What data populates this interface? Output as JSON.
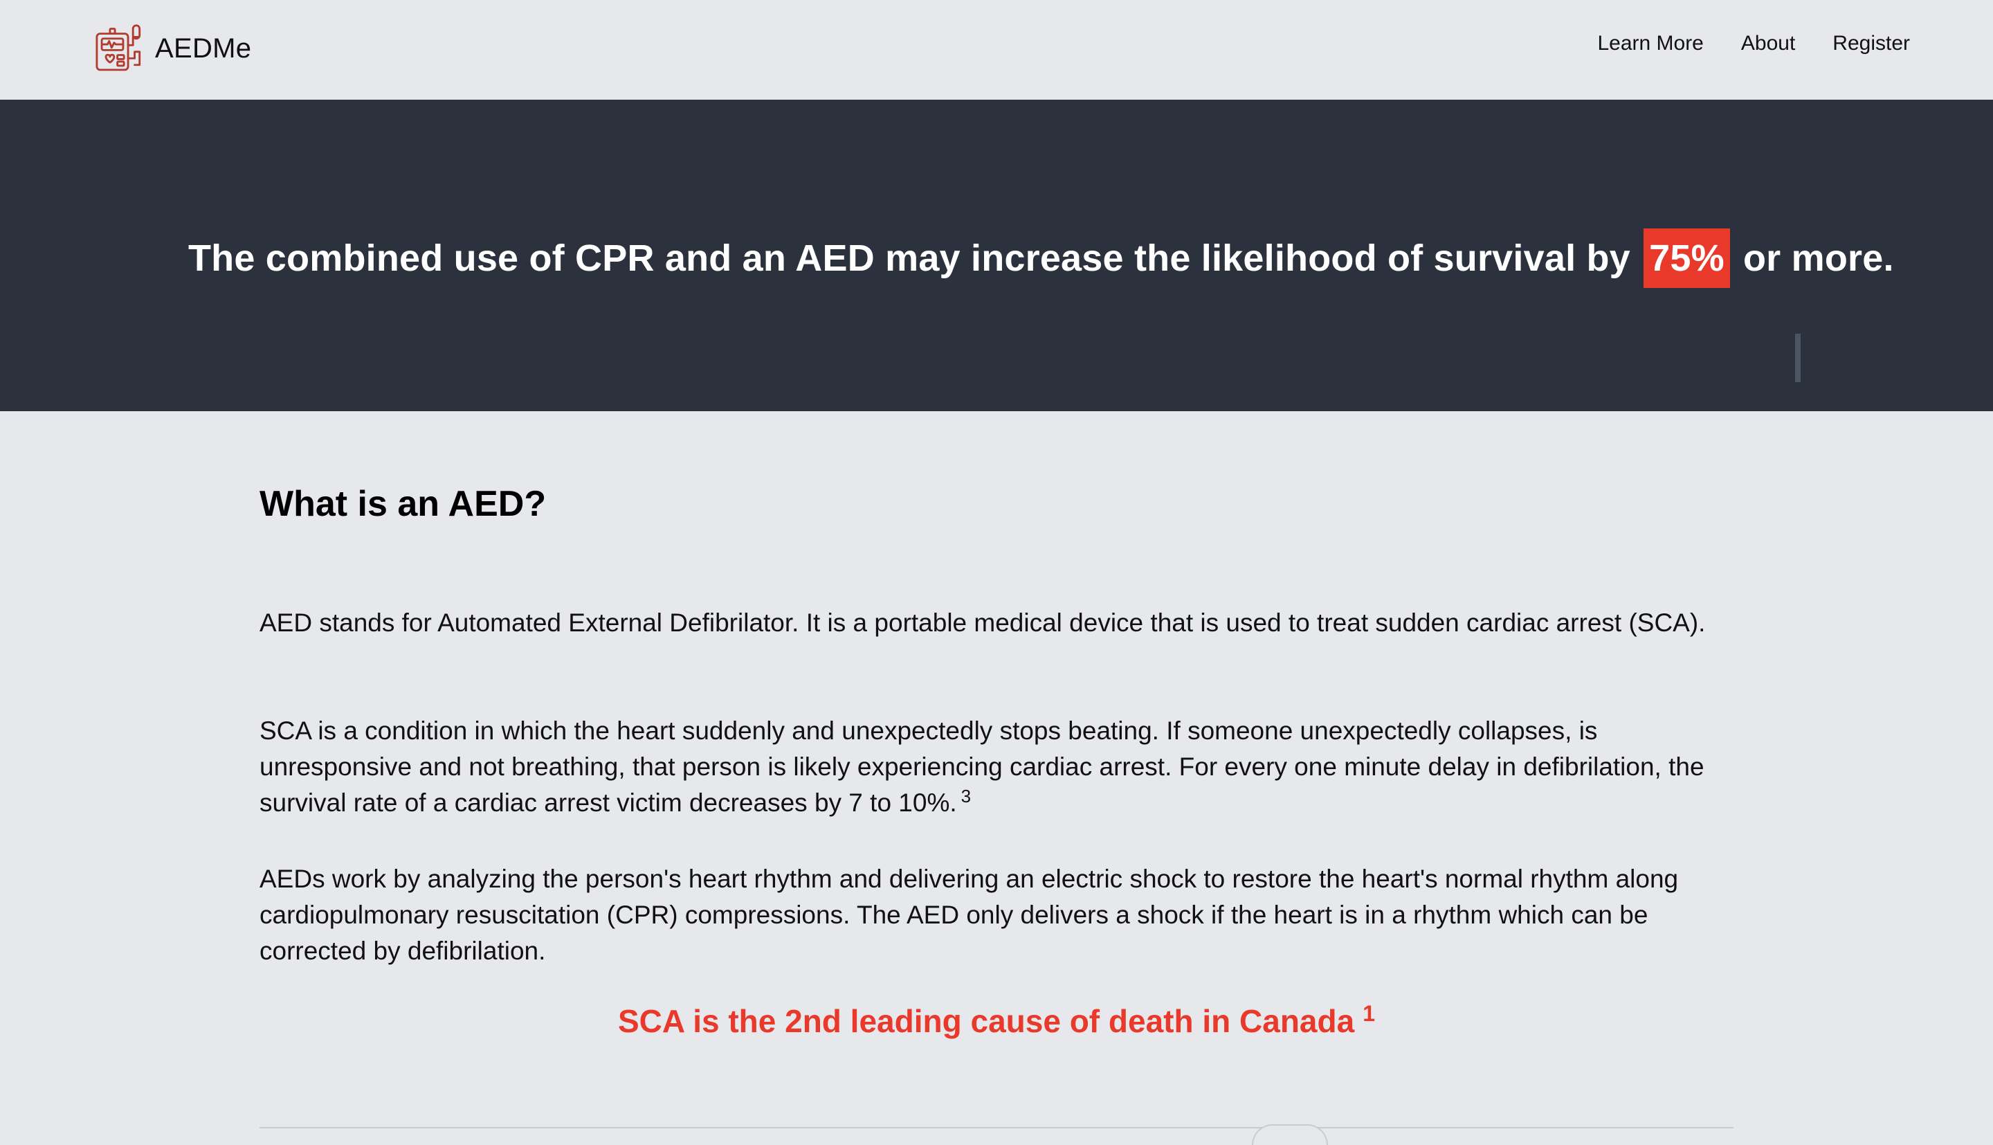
{
  "nav": {
    "brand_name": "AEDMe",
    "brand_logo_icon": "aed-device-icon",
    "links": [
      {
        "label": "Learn More"
      },
      {
        "label": "About"
      },
      {
        "label": "Register"
      }
    ]
  },
  "hero": {
    "text_before": "The combined use of CPR and an AED may increase the likelihood of survival by",
    "highlight": "75%",
    "text_after": "or more.",
    "highlight_color": "#e8392b",
    "background_color": "#2c323d"
  },
  "section": {
    "heading": "What is an AED?",
    "paragraph_1": "AED stands for Automated External Defibrilator. It is a portable medical device that is used to treat sudden cardiac arrest (SCA).",
    "paragraph_2": "SCA is a condition in which the heart suddenly and unexpectedly stops beating. If someone unexpectedly collapses, is unresponsive and not breathing, that person is likely experiencing cardiac arrest. For every one minute delay in defibrilation, the survival rate of a cardiac arrest victim decreases by 7 to 10%.",
    "paragraph_2_ref": "3",
    "paragraph_3": "AEDs work by analyzing the person's heart rhythm and delivering an electric shock to restore the heart's normal rhythm along cardiopulmonary resuscitation (CPR) compressions. The AED only delivers a shock if the heart is in a rhythm which can be corrected by defibrilation.",
    "callout": "SCA is the 2nd leading cause of death in Canada",
    "callout_ref": "1",
    "callout_color": "#e8392b"
  }
}
